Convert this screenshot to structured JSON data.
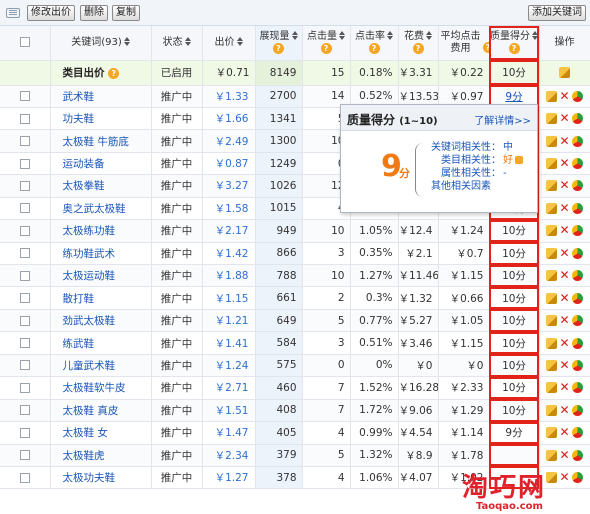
{
  "toolbar": {
    "edit_bid": "修改出价",
    "delete": "删除",
    "copy": "复制",
    "add_keyword": "添加关键词"
  },
  "columns": {
    "keyword": "关键词(93)",
    "status": "状态",
    "bid": "出价",
    "impressions": "展现量",
    "clicks": "点击量",
    "ctr": "点击率",
    "spend": "花费",
    "avg_cpc": "平均点击费用",
    "quality": "质量得分",
    "actions": "操作"
  },
  "summary": {
    "keyword": "类目出价",
    "status": "已启用",
    "bid": "￥0.71",
    "impressions": "8149",
    "clicks": "15",
    "ctr": "0.18%",
    "spend": "￥3.31",
    "avg_cpc": "￥0.22",
    "quality": "10分"
  },
  "rows": [
    {
      "keyword": "武术鞋",
      "status": "推广中",
      "bid": "￥1.33",
      "impressions": "2700",
      "clicks": "14",
      "ctr": "0.52%",
      "spend": "￥13.53",
      "avg_cpc": "￥0.97",
      "quality": "9分"
    },
    {
      "keyword": "功夫鞋",
      "status": "推广中",
      "bid": "￥1.66",
      "impressions": "1341",
      "clicks": "5",
      "ctr": "",
      "spend": "",
      "avg_cpc": "",
      "quality": ""
    },
    {
      "keyword": "太极鞋 牛筋底",
      "status": "推广中",
      "bid": "￥2.49",
      "impressions": "1300",
      "clicks": "10",
      "ctr": "",
      "spend": "",
      "avg_cpc": "",
      "quality": ""
    },
    {
      "keyword": "运动装备",
      "status": "推广中",
      "bid": "￥0.87",
      "impressions": "1249",
      "clicks": "0",
      "ctr": "",
      "spend": "",
      "avg_cpc": "",
      "quality": ""
    },
    {
      "keyword": "太极拳鞋",
      "status": "推广中",
      "bid": "￥3.27",
      "impressions": "1026",
      "clicks": "12",
      "ctr": "",
      "spend": "",
      "avg_cpc": "",
      "quality": ""
    },
    {
      "keyword": "奥之武太极鞋",
      "status": "推广中",
      "bid": "￥1.58",
      "impressions": "1015",
      "clicks": "4",
      "ctr": "0.39%",
      "spend": "￥4.40",
      "avg_cpc": "",
      "quality": "10分"
    },
    {
      "keyword": "太极练功鞋",
      "status": "推广中",
      "bid": "￥2.17",
      "impressions": "949",
      "clicks": "10",
      "ctr": "1.05%",
      "spend": "￥12.4",
      "avg_cpc": "￥1.24",
      "quality": "10分"
    },
    {
      "keyword": "练功鞋武术",
      "status": "推广中",
      "bid": "￥1.42",
      "impressions": "866",
      "clicks": "3",
      "ctr": "0.35%",
      "spend": "￥2.1",
      "avg_cpc": "￥0.7",
      "quality": "10分"
    },
    {
      "keyword": "太极运动鞋",
      "status": "推广中",
      "bid": "￥1.88",
      "impressions": "788",
      "clicks": "10",
      "ctr": "1.27%",
      "spend": "￥11.46",
      "avg_cpc": "￥1.15",
      "quality": "10分"
    },
    {
      "keyword": "散打鞋",
      "status": "推广中",
      "bid": "￥1.15",
      "impressions": "661",
      "clicks": "2",
      "ctr": "0.3%",
      "spend": "￥1.32",
      "avg_cpc": "￥0.66",
      "quality": "10分"
    },
    {
      "keyword": "劲武太极鞋",
      "status": "推广中",
      "bid": "￥1.21",
      "impressions": "649",
      "clicks": "5",
      "ctr": "0.77%",
      "spend": "￥5.27",
      "avg_cpc": "￥1.05",
      "quality": "10分"
    },
    {
      "keyword": "练武鞋",
      "status": "推广中",
      "bid": "￥1.41",
      "impressions": "584",
      "clicks": "3",
      "ctr": "0.51%",
      "spend": "￥3.46",
      "avg_cpc": "￥1.15",
      "quality": "10分"
    },
    {
      "keyword": "儿童武术鞋",
      "status": "推广中",
      "bid": "￥1.24",
      "impressions": "575",
      "clicks": "0",
      "ctr": "0%",
      "spend": "￥0",
      "avg_cpc": "￥0",
      "quality": "10分"
    },
    {
      "keyword": "太极鞋软牛皮",
      "status": "推广中",
      "bid": "￥2.71",
      "impressions": "460",
      "clicks": "7",
      "ctr": "1.52%",
      "spend": "￥16.28",
      "avg_cpc": "￥2.33",
      "quality": "10分"
    },
    {
      "keyword": "太极鞋 真皮",
      "status": "推广中",
      "bid": "￥1.51",
      "impressions": "408",
      "clicks": "7",
      "ctr": "1.72%",
      "spend": "￥9.06",
      "avg_cpc": "￥1.29",
      "quality": "10分"
    },
    {
      "keyword": "太极鞋 女",
      "status": "推广中",
      "bid": "￥1.47",
      "impressions": "405",
      "clicks": "4",
      "ctr": "0.99%",
      "spend": "￥4.54",
      "avg_cpc": "￥1.14",
      "quality": "9分"
    },
    {
      "keyword": "太极鞋虎",
      "status": "推广中",
      "bid": "￥2.34",
      "impressions": "379",
      "clicks": "5",
      "ctr": "1.32%",
      "spend": "￥8.9",
      "avg_cpc": "￥1.78",
      "quality": ""
    },
    {
      "keyword": "太极功夫鞋",
      "status": "推广中",
      "bid": "￥1.27",
      "impressions": "378",
      "clicks": "4",
      "ctr": "1.06%",
      "spend": "￥4.07",
      "avg_cpc": "￥1.02",
      "quality": ""
    }
  ],
  "popup": {
    "title": "质量得分",
    "range": "(1~10)",
    "more": "了解详情>>",
    "score": "9",
    "unit": "分",
    "f1_label": "关键词相关性：",
    "f1_value": "中",
    "f2_label": "类目相关性：",
    "f2_value": "好",
    "f3_label": "属性相关性：",
    "f3_value": "-",
    "f4_label": "其他相关因素"
  },
  "watermark": {
    "cn": "淘巧网",
    "en": "Taoqao.com"
  },
  "icons": {
    "help": "question-circle-icon",
    "edit": "pencil-icon",
    "delete": "x-icon",
    "chart": "pie-chart-icon"
  },
  "colors": {
    "link": "#1a56b8",
    "highlight": "#e2231a",
    "score": "#f07a16"
  }
}
